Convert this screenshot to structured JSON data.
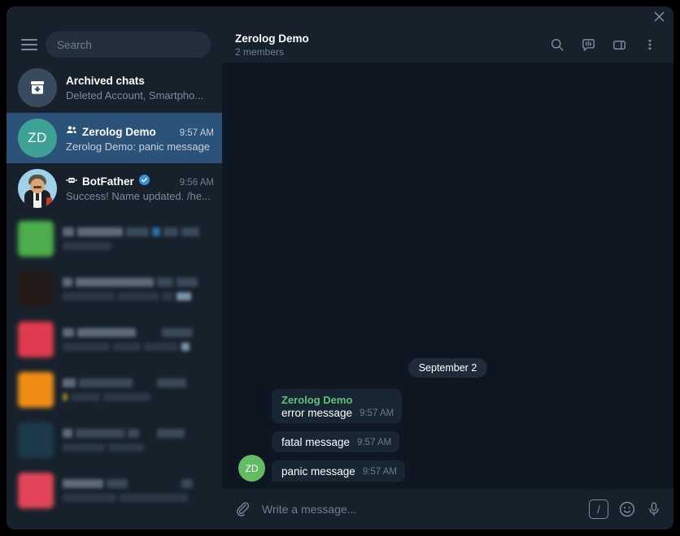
{
  "window": {
    "close_label": "×"
  },
  "sidebar": {
    "menu_icon": "hamburger-menu-icon",
    "search": {
      "placeholder": "Search",
      "value": ""
    },
    "archived": {
      "title": "Archived chats",
      "subtitle": "Deleted Account, Smartpho...",
      "icon": "archive-box-icon"
    },
    "chats": [
      {
        "avatar_initials": "ZD",
        "avatar_color": "#3fa196",
        "title": "Zerolog Demo",
        "time": "9:57 AM",
        "preview": "Zerolog Demo: panic message",
        "badge_icon": "group-icon",
        "selected": true
      },
      {
        "avatar_initials": "",
        "avatar_color": "#9fd2e8",
        "title": "BotFather",
        "time": "9:56 AM",
        "preview": "Success! Name updated. /he...",
        "badge_icon": "bot-icon",
        "verified": true,
        "selected": false
      }
    ],
    "hidden_rows": [
      {
        "avatar_color": "#4cae4c"
      },
      {
        "avatar_color": "#241a18"
      },
      {
        "avatar_color": "#e03b4e"
      },
      {
        "avatar_color": "#ef8c16"
      },
      {
        "avatar_color": "#1c3a4a"
      },
      {
        "avatar_color": "#e2455a"
      }
    ]
  },
  "chat_header": {
    "title": "Zerolog Demo",
    "subtitle": "2 members",
    "actions": [
      {
        "name": "search-icon"
      },
      {
        "name": "topics-icon"
      },
      {
        "name": "info-panel-icon"
      },
      {
        "name": "more-menu-icon"
      }
    ]
  },
  "conversation": {
    "date_separator": "September 2",
    "messages": [
      {
        "sender": "Zerolog Demo",
        "text": "error message",
        "time": "9:57 AM",
        "show_sender": true,
        "show_avatar": false
      },
      {
        "sender": "Zerolog Demo",
        "text": "fatal message",
        "time": "9:57 AM",
        "show_sender": false,
        "show_avatar": false
      },
      {
        "sender": "Zerolog Demo",
        "text": "panic message",
        "time": "9:57 AM",
        "show_sender": false,
        "show_avatar": true,
        "avatar_initials": "ZD",
        "avatar_color": "#63bb63"
      }
    ]
  },
  "composer": {
    "attach_icon": "paperclip-icon",
    "placeholder": "Write a message...",
    "command_label": "/",
    "emoji_icon": "smiley-icon",
    "mic_icon": "microphone-icon"
  },
  "colors": {
    "accent_selected": "#2b5278",
    "sidebar_bg": "#17212b",
    "chat_bg": "#0e1621",
    "bubble_bg": "#182533",
    "sender_green": "#64bf7a"
  }
}
